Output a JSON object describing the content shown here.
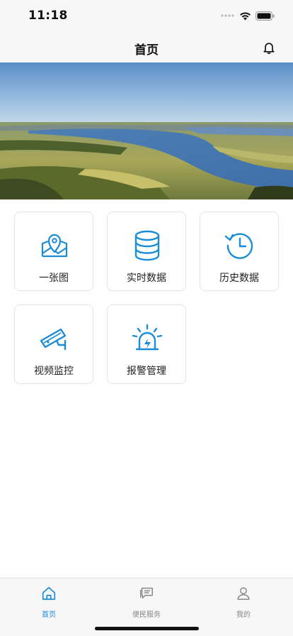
{
  "status_bar": {
    "time": "11:18"
  },
  "nav": {
    "title": "首页",
    "bell_icon": "bell-icon"
  },
  "grid": {
    "items": [
      {
        "label": "一张图",
        "icon": "map-pin-icon"
      },
      {
        "label": "实时数据",
        "icon": "database-icon"
      },
      {
        "label": "历史数据",
        "icon": "history-clock-icon"
      },
      {
        "label": "视频监控",
        "icon": "cctv-camera-icon"
      },
      {
        "label": "报警管理",
        "icon": "alarm-siren-icon"
      }
    ]
  },
  "tabbar": {
    "items": [
      {
        "label": "首页",
        "icon": "home-icon",
        "active": true
      },
      {
        "label": "便民服务",
        "icon": "message-icon",
        "active": false
      },
      {
        "label": "我的",
        "icon": "user-icon",
        "active": false
      }
    ]
  },
  "colors": {
    "accent": "#1a8cd8",
    "inactive": "#888888"
  }
}
